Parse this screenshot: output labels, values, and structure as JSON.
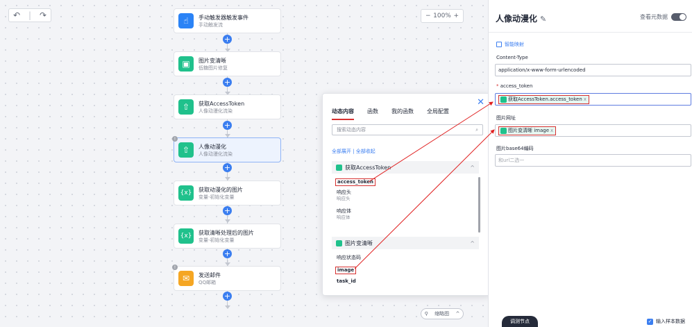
{
  "toolbar": {
    "undo_icon": "undo-icon",
    "redo_icon": "redo-icon"
  },
  "zoom": {
    "minus": "−",
    "value": "100%",
    "plus": "+"
  },
  "flow": {
    "nodes": [
      {
        "title": "手动触发器触发事件",
        "sub": "手动触发流",
        "icon": "hand-icon",
        "color": "#2b83f6",
        "glyph": "☝"
      },
      {
        "title": "图片变清晰",
        "sub": "低糖图片修复",
        "icon": "image-icon",
        "color": "#20c18c",
        "glyph": "▣"
      },
      {
        "title": "获取AccessToken",
        "sub": "人像动漫化流染",
        "icon": "cloud-upload-icon",
        "color": "#20c18c",
        "glyph": "⇧"
      },
      {
        "title": "人像动漫化",
        "sub": "人像动漫化流染",
        "icon": "cloud-upload-icon",
        "color": "#20c18c",
        "glyph": "⇧"
      },
      {
        "title": "获取动漫化的图片",
        "sub": "变量-初始化变量",
        "icon": "variable-icon",
        "color": "#20c18c",
        "glyph": "{x}"
      },
      {
        "title": "获取清晰处理后的图片",
        "sub": "变量-初始化变量",
        "icon": "variable-icon",
        "color": "#20c18c",
        "glyph": "{x}"
      },
      {
        "title": "发送邮件",
        "sub": "QQ邮箱",
        "icon": "mail-icon",
        "color": "#f5a623",
        "glyph": "✉"
      }
    ]
  },
  "minimap": {
    "label": "缩略图",
    "chevron": "^"
  },
  "dynamic_panel": {
    "tabs": [
      "动态内容",
      "函数",
      "我的函数",
      "全局配置"
    ],
    "search_placeholder": "搜索动态内容",
    "expand_all": "全部展开 | 全部收起",
    "groups": [
      {
        "name": "获取AccessToken",
        "items": [
          {
            "label": "access_token",
            "sub": ""
          },
          {
            "label": "响应头",
            "sub": "响应头"
          },
          {
            "label": "响应体",
            "sub": "响应体"
          }
        ]
      },
      {
        "name": "图片变清晰",
        "items": [
          {
            "label": "响应状态码",
            "sub": ""
          },
          {
            "label": "image",
            "sub": ""
          },
          {
            "label": "task_id",
            "sub": ""
          }
        ]
      }
    ]
  },
  "right_panel": {
    "title": "人像动漫化",
    "meta_label": "查看元数据",
    "smart_mapping": "智能映射",
    "fields": [
      {
        "label": "Content-Type",
        "value": "application/x-www-form-urlencoded",
        "required": false
      },
      {
        "label": "access_token",
        "chip": "获取AccessToken.access_token",
        "required": true
      },
      {
        "label": "图片网址",
        "chip": "图片变清晰 image",
        "required": false
      },
      {
        "label": "图片base64编码",
        "placeholder": "和url二选一",
        "required": false
      }
    ],
    "debug_button": "调测节点",
    "sample_checkbox": "输入样本数据"
  }
}
